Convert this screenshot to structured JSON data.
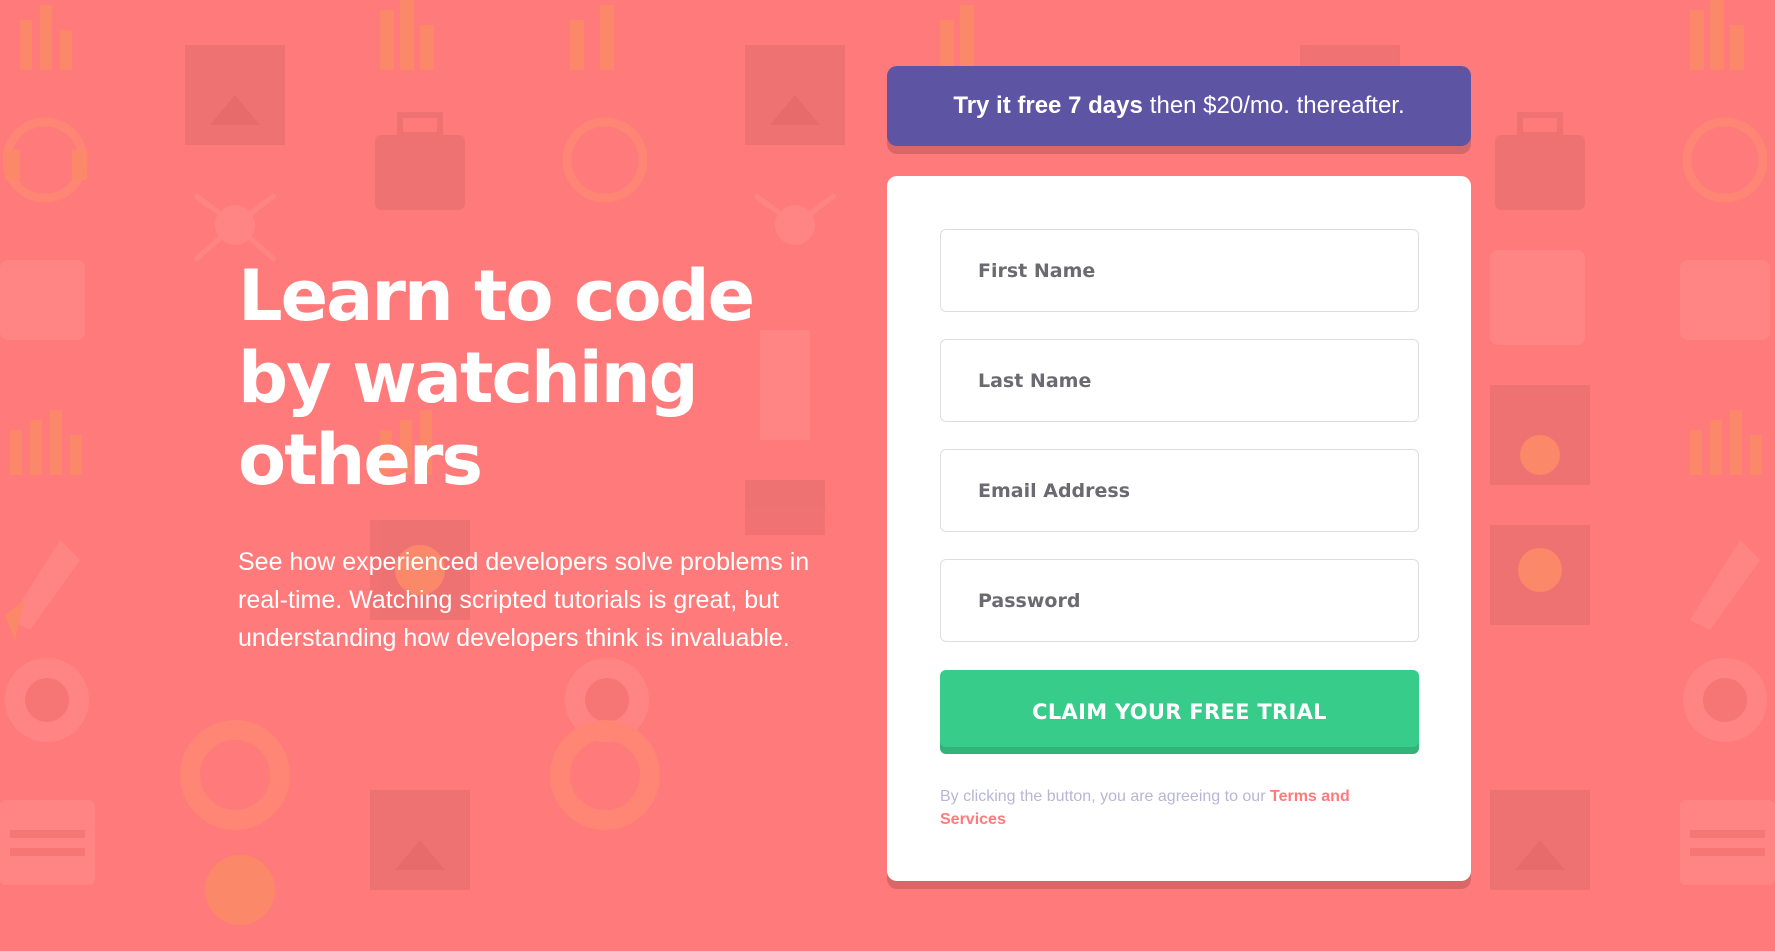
{
  "colors": {
    "background": "#ff7a7a",
    "banner": "#5e54a4",
    "button": "#38cc8b",
    "link": "#ff7a7a",
    "muted_text": "#b9b6d3"
  },
  "hero": {
    "title": "Learn to code by watching others",
    "description": "See how experienced developers solve problems in real-time. Watching scripted tutorials is great, but understanding how developers think is invaluable."
  },
  "promo": {
    "highlight": "Try it free 7 days",
    "rest": "then $20/mo. thereafter."
  },
  "form": {
    "first_name_placeholder": "First Name",
    "last_name_placeholder": "Last Name",
    "email_placeholder": "Email Address",
    "password_placeholder": "Password",
    "submit_label": "CLAIM YOUR FREE TRIAL",
    "terms_text": "By clicking the button, you are agreeing to our",
    "terms_link": "Terms and Services"
  },
  "background_pattern": {
    "icons": [
      "chart-icon",
      "browser-icon",
      "headset-icon",
      "network-icon",
      "thumbs-up-icon",
      "toolbox-icon",
      "rocket-icon",
      "globe-gear-icon",
      "lifebuoy-icon",
      "calendar-icon",
      "lightbulb-icon",
      "magnifier-icon"
    ]
  }
}
